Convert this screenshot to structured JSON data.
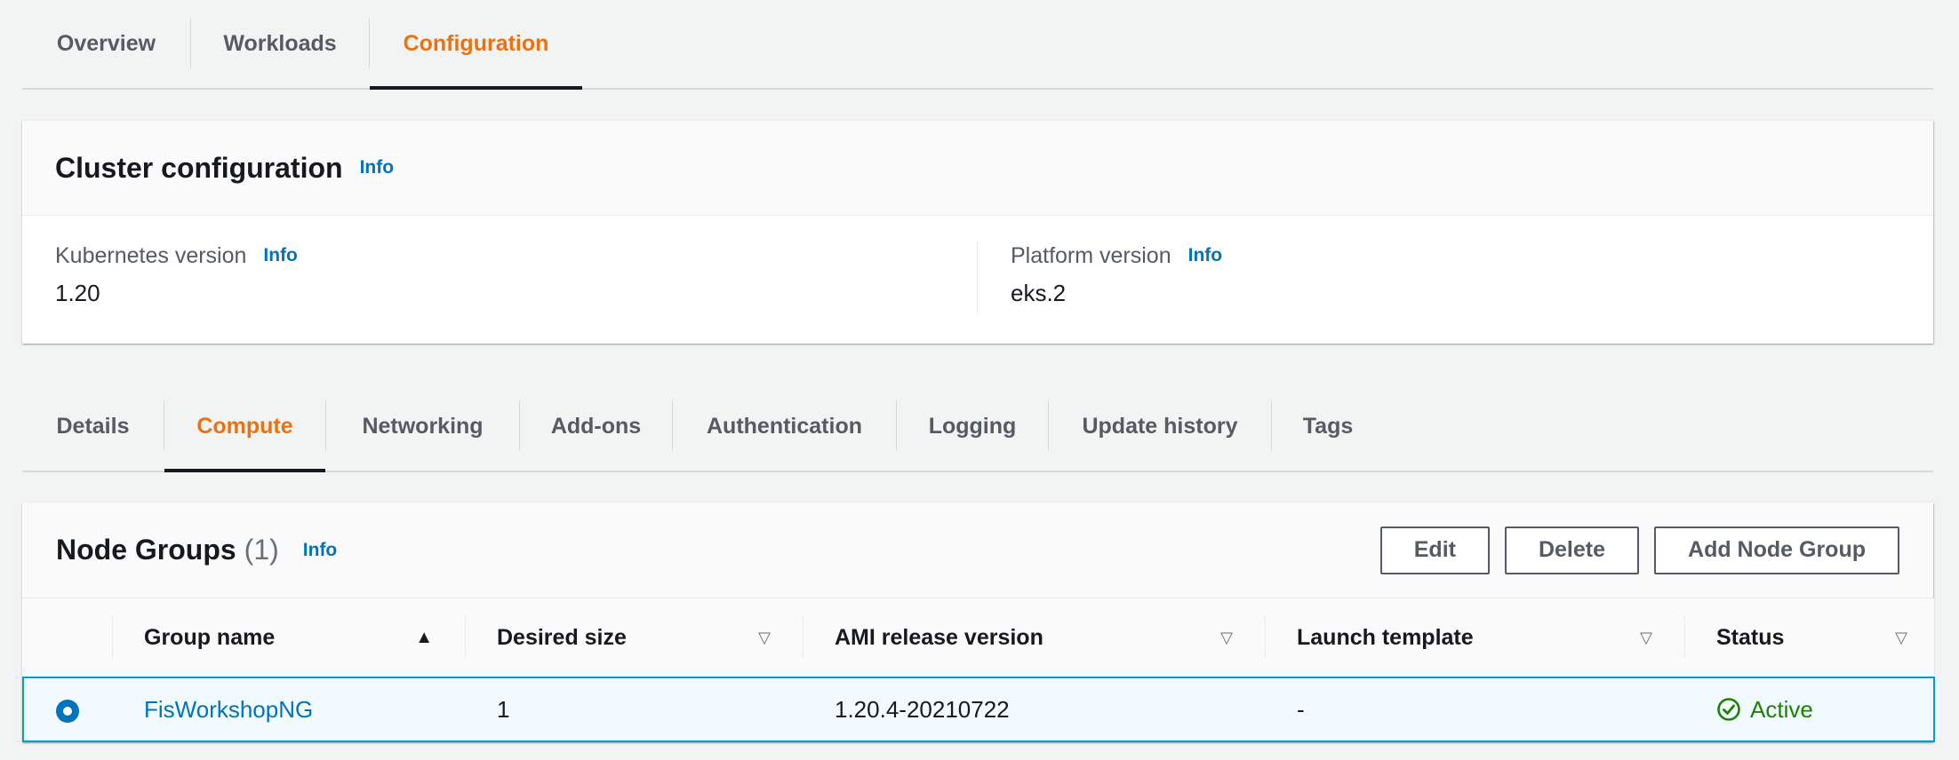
{
  "top_tabs": [
    {
      "label": "Overview",
      "active": false
    },
    {
      "label": "Workloads",
      "active": false
    },
    {
      "label": "Configuration",
      "active": true
    }
  ],
  "cluster_config": {
    "title": "Cluster configuration",
    "info": "Info",
    "kubernetes_version": {
      "label": "Kubernetes version",
      "info": "Info",
      "value": "1.20"
    },
    "platform_version": {
      "label": "Platform version",
      "info": "Info",
      "value": "eks.2"
    }
  },
  "sub_tabs": [
    {
      "label": "Details",
      "active": false
    },
    {
      "label": "Compute",
      "active": true
    },
    {
      "label": "Networking",
      "active": false
    },
    {
      "label": "Add-ons",
      "active": false
    },
    {
      "label": "Authentication",
      "active": false
    },
    {
      "label": "Logging",
      "active": false
    },
    {
      "label": "Update history",
      "active": false
    },
    {
      "label": "Tags",
      "active": false
    }
  ],
  "node_groups": {
    "title": "Node Groups",
    "count": "(1)",
    "info": "Info",
    "buttons": {
      "edit": "Edit",
      "delete": "Delete",
      "add": "Add Node Group"
    },
    "columns": [
      {
        "label": "Group name",
        "sort": "asc"
      },
      {
        "label": "Desired size",
        "sort": "none"
      },
      {
        "label": "AMI release version",
        "sort": "none"
      },
      {
        "label": "Launch template",
        "sort": "none"
      },
      {
        "label": "Status",
        "sort": "none"
      }
    ],
    "rows": [
      {
        "selected": true,
        "group_name": "FisWorkshopNG",
        "desired_size": "1",
        "ami_release_version": "1.20.4-20210722",
        "launch_template": "-",
        "status": "Active"
      }
    ]
  },
  "colors": {
    "accent_orange": "#ec7211",
    "link_blue": "#0073bb",
    "status_green": "#1d8102",
    "selected_border": "#00a1c9"
  },
  "icons": {
    "sort_asc": "triangle-up-filled-icon",
    "sort_none": "triangle-down-outline-icon",
    "status_ok": "check-circle-icon",
    "radio": "radio-selected-icon"
  }
}
